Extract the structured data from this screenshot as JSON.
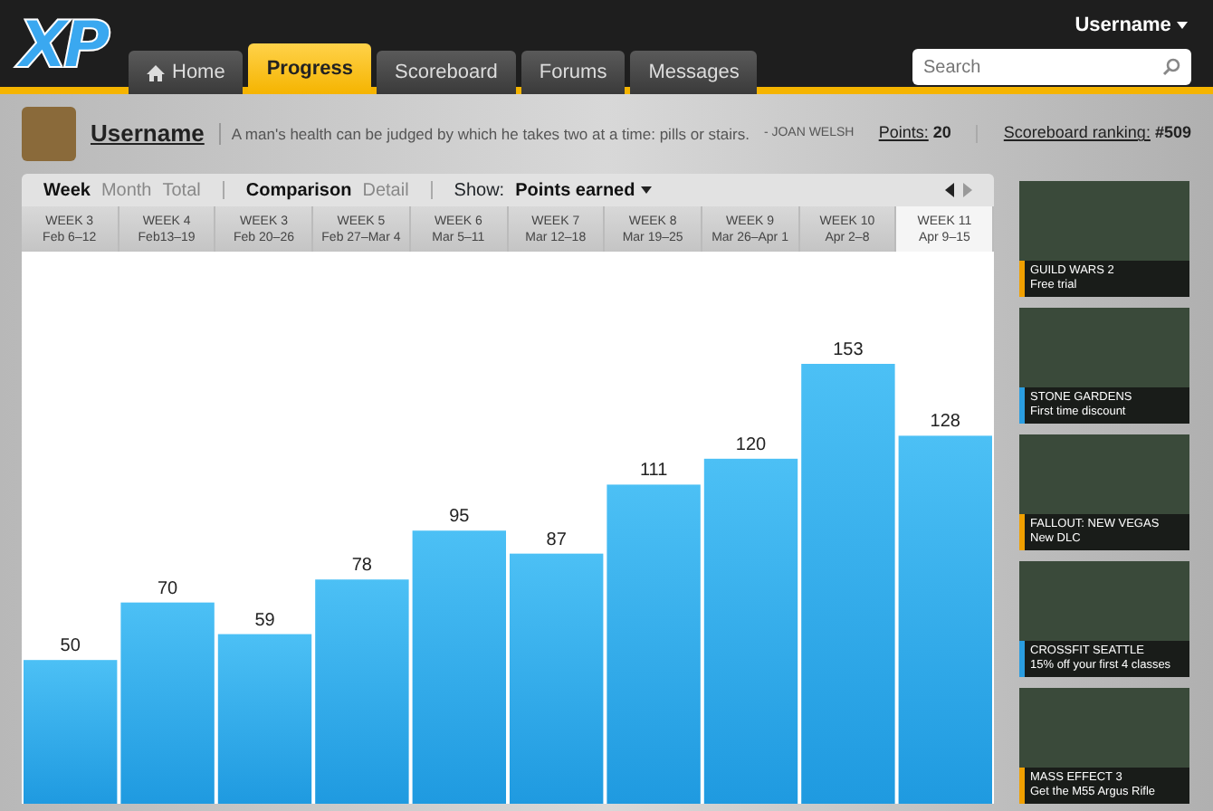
{
  "header": {
    "logo": "XP",
    "user_menu": "Username",
    "search": {
      "placeholder": "Search"
    },
    "nav": [
      {
        "label": "Home",
        "selected": false,
        "kind": "home"
      },
      {
        "label": "Progress",
        "selected": true,
        "kind": "plain"
      },
      {
        "label": "Scoreboard",
        "selected": false,
        "kind": "plain"
      },
      {
        "label": "Forums",
        "selected": false,
        "kind": "plain"
      },
      {
        "label": "Messages",
        "selected": false,
        "kind": "plain"
      }
    ]
  },
  "profile": {
    "username": "Username",
    "quote": "A man's health can be judged by which he takes two at a time: pills or stairs.",
    "quote_author": "- JOAN WELSH",
    "points_label": "Points:",
    "points": "20",
    "ranking_label": "Scoreboard ranking:",
    "ranking": "#509"
  },
  "toolbar": {
    "periods": [
      {
        "label": "Week",
        "selected": true
      },
      {
        "label": "Month",
        "selected": false
      },
      {
        "label": "Total",
        "selected": false
      }
    ],
    "views": [
      {
        "label": "Comparison",
        "selected": true
      },
      {
        "label": "Detail",
        "selected": false
      }
    ],
    "show_label": "Show:",
    "show_value": "Points earned"
  },
  "weeks": [
    {
      "dates": "Feb 6–12",
      "selected": false
    },
    {
      "dates": "Feb13–19",
      "selected": false
    },
    {
      "dates": "Feb 20–26",
      "selected": false
    },
    {
      "dates": "Feb 27–Mar 4",
      "selected": false
    },
    {
      "dates": "Mar 5–11",
      "selected": false
    },
    {
      "dates": "Mar 12–18",
      "selected": false
    },
    {
      "dates": "Mar 19–25",
      "selected": false
    },
    {
      "dates": "Mar 26–Apr 1",
      "selected": false
    },
    {
      "dates": "Apr 2–8",
      "selected": false
    },
    {
      "dates": "Apr 9–15",
      "selected": true
    }
  ],
  "chart_data": {
    "type": "bar",
    "categories": [
      "WEEK 3",
      "WEEK 4",
      "WEEK 3",
      "WEEK 5",
      "WEEK 6",
      "WEEK 7",
      "WEEK 8",
      "WEEK 9",
      "WEEK 10",
      "WEEK 11"
    ],
    "values": [
      50,
      70,
      59,
      78,
      95,
      87,
      111,
      120,
      153,
      128
    ],
    "data_labels": true
  },
  "ads": [
    {
      "title": "GUILD WARS 2",
      "subtitle": "Free trial",
      "color": "#f0a000"
    },
    {
      "title": "STONE GARDENS",
      "subtitle": "First time discount",
      "color": "#2a9de0"
    },
    {
      "title": "FALLOUT: NEW VEGAS",
      "subtitle": "New DLC",
      "color": "#f0a000"
    },
    {
      "title": "CROSSFIT SEATTLE",
      "subtitle": "15% off your first 4 classes",
      "color": "#2a9de0"
    },
    {
      "title": "MASS EFFECT 3",
      "subtitle": "Get the M55 Argus Rifle",
      "color": "#f0a000"
    }
  ]
}
